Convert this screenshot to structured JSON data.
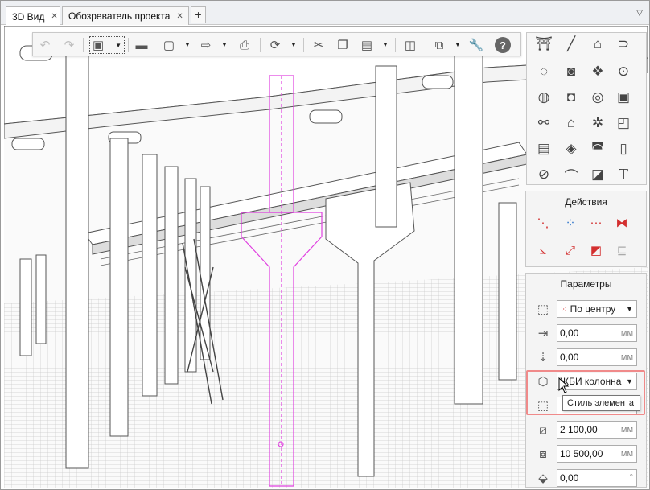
{
  "tabs": [
    {
      "label": "3D Вид",
      "active": true
    },
    {
      "label": "Обозреватель проекта",
      "active": false
    }
  ],
  "toolbar": {
    "buttons": [
      "undo-icon",
      "redo-icon",
      "view-cube-icon",
      "open-folder-icon",
      "save-icon",
      "export-icon",
      "print-icon",
      "orbit-icon",
      "cut-icon",
      "copy-icon",
      "paste-icon",
      "layers-icon",
      "sheets-icon",
      "settings-wrench-icon",
      "help-icon"
    ]
  },
  "actions": {
    "title": "Действия"
  },
  "params": {
    "title": "Параметры",
    "rows": [
      {
        "name": "anchor",
        "icon": "anchor-point-icon",
        "type": "select",
        "value": "По центру"
      },
      {
        "name": "offset-x",
        "icon": "offset-x-icon",
        "type": "field",
        "value": "0,00",
        "unit": "мм"
      },
      {
        "name": "offset-y",
        "icon": "offset-y-icon",
        "type": "field",
        "value": "0,00",
        "unit": "мм"
      },
      {
        "name": "element-style",
        "icon": "element-style-icon",
        "type": "select",
        "value": "ЖБИ колонна"
      },
      {
        "name": "width",
        "icon": "width-icon",
        "type": "field",
        "value": "",
        "unit": ""
      },
      {
        "name": "depth",
        "icon": "depth-icon",
        "type": "field",
        "value": "2 100,00",
        "unit": "мм"
      },
      {
        "name": "height",
        "icon": "height-icon",
        "type": "field",
        "value": "10 500,00",
        "unit": "мм"
      },
      {
        "name": "rotation",
        "icon": "rotation-icon",
        "type": "field",
        "value": "0,00",
        "unit": "°"
      }
    ]
  },
  "tooltip": "Стиль элемента",
  "colors": {
    "selection": "#e040e0",
    "highlight": "#f08a8a",
    "accent": "#2a72c9",
    "action_red": "#d32f2f"
  }
}
